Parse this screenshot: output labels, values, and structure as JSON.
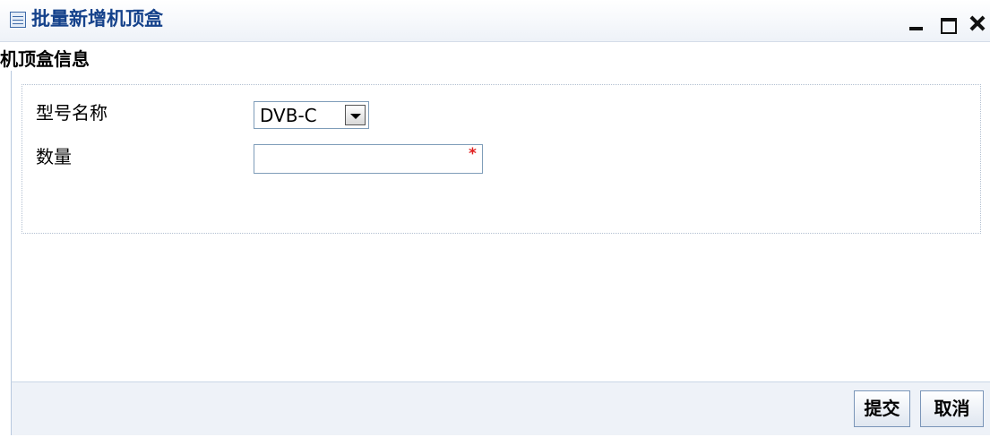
{
  "window": {
    "title": "批量新增机顶盒",
    "icon": "table-icon",
    "controls": [
      "minimize-icon",
      "maximize-icon",
      "close-icon"
    ]
  },
  "section": {
    "title": "机顶盒信息"
  },
  "form": {
    "model_label": "型号名称",
    "model_value": "DVB-C",
    "quantity_label": "数量",
    "quantity_value": "",
    "required_marker": "*",
    "required_color": "#e02020"
  },
  "footer": {
    "submit_label": "提交",
    "cancel_label": "取消"
  },
  "colors": {
    "title_text": "#15428b",
    "panel_bg": "#eef2f8",
    "border": "#b8c9df"
  }
}
